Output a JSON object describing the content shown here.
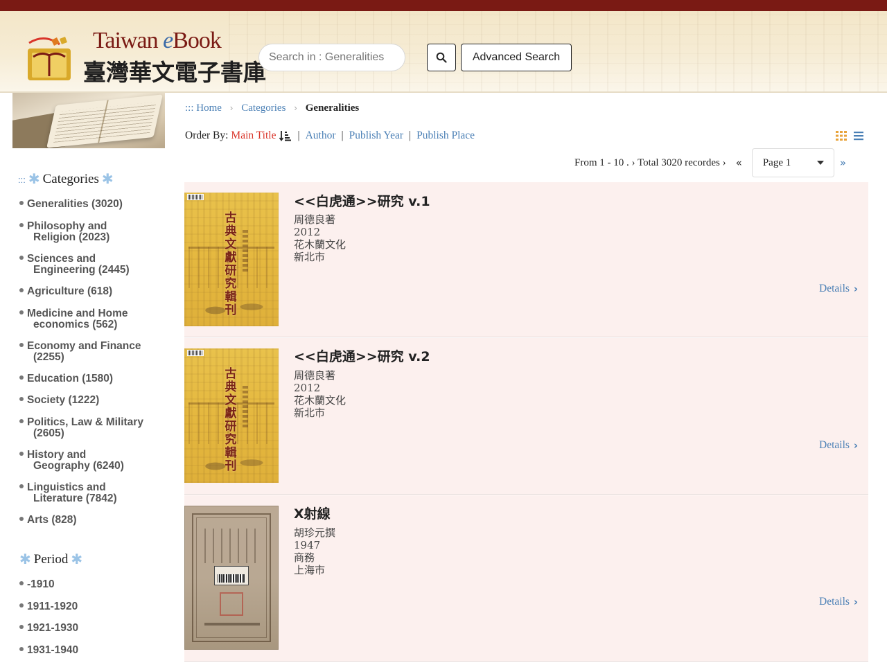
{
  "header": {
    "logo_title_pre": "Taiwan ",
    "logo_title_e": "e",
    "logo_title_post": "Book",
    "logo_subtitle": "臺灣華文電子書庫",
    "search_placeholder": "Search in : Generalities",
    "search_icon": "magnifier-icon",
    "advanced_label": "Advanced Search"
  },
  "sidebar": {
    "categories_prefix": ":::",
    "categories_title": "Categories",
    "categories": [
      {
        "line1": "Generalities (3020)",
        "line2": ""
      },
      {
        "line1": "Philosophy and",
        "line2": "Religion (2023)"
      },
      {
        "line1": "Sciences and",
        "line2": "Engineering (2445)"
      },
      {
        "line1": "Agriculture (618)",
        "line2": ""
      },
      {
        "line1": "Medicine and Home",
        "line2": "economics (562)"
      },
      {
        "line1": "Economy and Finance",
        "line2": "(2255)"
      },
      {
        "line1": "Education (1580)",
        "line2": ""
      },
      {
        "line1": "Society (1222)",
        "line2": ""
      },
      {
        "line1": "Politics, Law & Military",
        "line2": "(2605)"
      },
      {
        "line1": "History and",
        "line2": "Geography (6240)"
      },
      {
        "line1": "Linguistics and",
        "line2": "Literature (7842)"
      },
      {
        "line1": "Arts (828)",
        "line2": ""
      }
    ],
    "period_title": "Period",
    "periods": [
      "-1910",
      "1911-1920",
      "1921-1930",
      "1931-1940"
    ]
  },
  "breadcrumb": {
    "home": "::: Home",
    "categories": "Categories",
    "current": "Generalities"
  },
  "order": {
    "label": "Order By:",
    "active": "Main Title",
    "options": [
      "Author",
      "Publish Year",
      "Publish Place"
    ]
  },
  "pager": {
    "range": "From 1 - 10 . ›  Total 3020 recordes ›",
    "first_symbol": "«",
    "page_label": "Page 1",
    "next_symbol": "»"
  },
  "books": [
    {
      "title": "<<白虎通>>研究 v.1",
      "author": "周德良著",
      "year": "2012",
      "publisher": "花木蘭文化",
      "place": "新北市",
      "cover_text": "古典文獻研究輯刊",
      "details": "Details"
    },
    {
      "title": "<<白虎通>>研究 v.2",
      "author": "周德良著",
      "year": "2012",
      "publisher": "花木蘭文化",
      "place": "新北市",
      "cover_text": "古典文獻研究輯刊",
      "details": "Details"
    },
    {
      "title": "X射線",
      "author": "胡珍元撰",
      "year": "1947",
      "publisher": "商務",
      "place": "上海市",
      "details": "Details"
    }
  ],
  "colors": {
    "topbar": "#7a1a14",
    "link": "#4a7fb5",
    "active_sort": "#d9352a",
    "card_bg": "#fcf0ee",
    "grid_icon": "#e8a33a"
  }
}
